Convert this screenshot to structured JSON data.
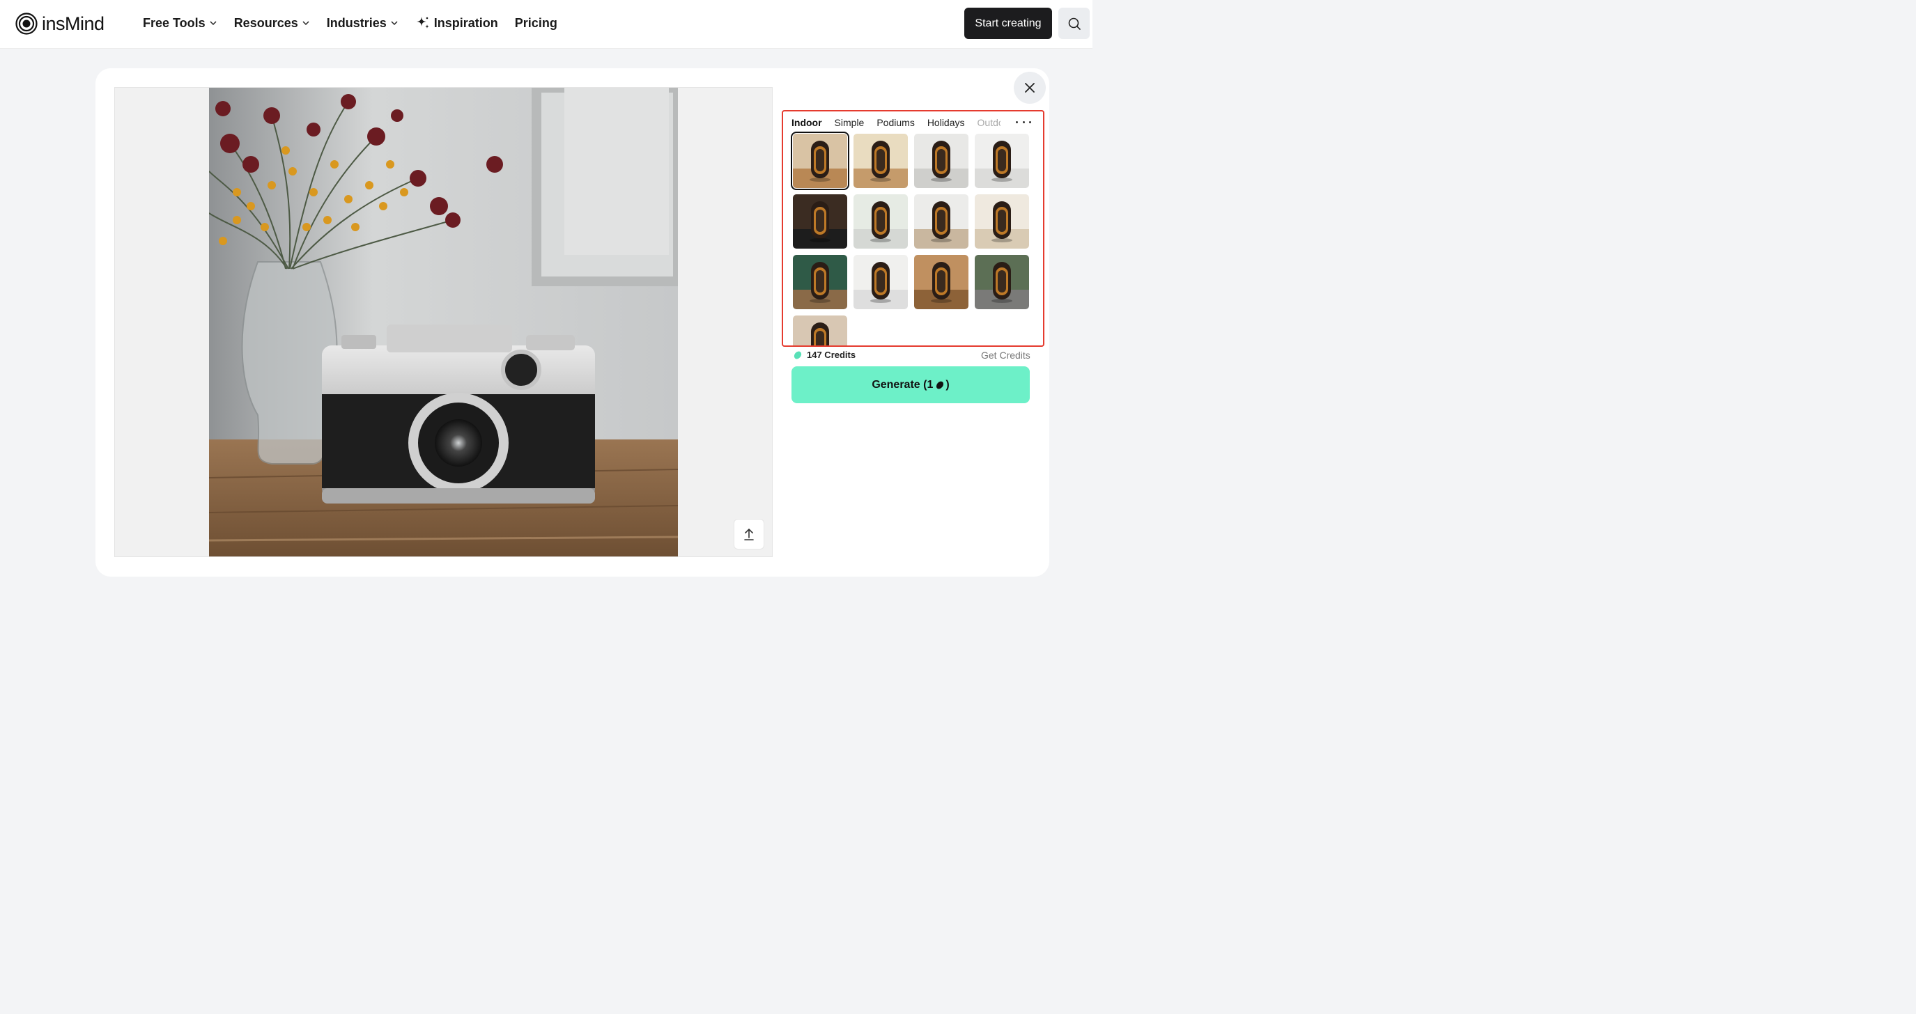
{
  "header": {
    "logo_text": "insMind",
    "nav": [
      {
        "label": "Free Tools",
        "has_dropdown": true
      },
      {
        "label": "Resources",
        "has_dropdown": true
      },
      {
        "label": "Industries",
        "has_dropdown": true
      },
      {
        "label": "Inspiration",
        "icon": "sparkle-icon"
      },
      {
        "label": "Pricing"
      }
    ],
    "start_label": "Start creating",
    "search_icon": "search-icon"
  },
  "editor": {
    "upload_icon": "upload-icon",
    "close_icon": "close-icon"
  },
  "picker": {
    "tabs": [
      "Indoor",
      "Simple",
      "Podiums",
      "Holidays",
      "Outdo"
    ],
    "active_tab": "Indoor",
    "more_icon": "more-icon",
    "thumbnails": [
      "indoor-1",
      "indoor-2",
      "indoor-3",
      "indoor-4",
      "indoor-5",
      "indoor-6",
      "indoor-7",
      "indoor-8",
      "indoor-9",
      "indoor-10",
      "indoor-11",
      "indoor-12",
      "indoor-13"
    ],
    "selected_index": 0
  },
  "credits": {
    "amount_label": "147 Credits",
    "get_label": "Get Credits"
  },
  "generate": {
    "label_prefix": "Generate (1",
    "label_suffix": ")"
  },
  "colors": {
    "accent": "#6df0c8",
    "highlight_border": "#e53b2f",
    "primary_button": "#1c1c1e"
  }
}
